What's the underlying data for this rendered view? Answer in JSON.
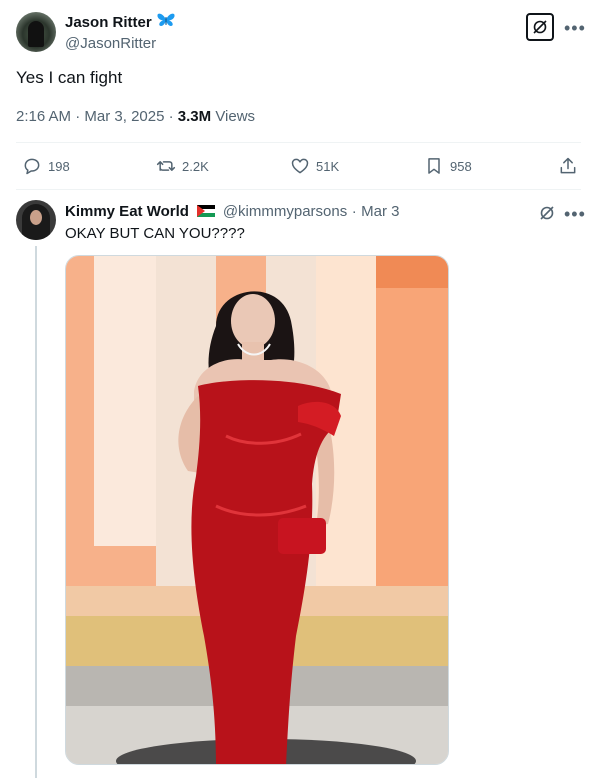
{
  "main_tweet": {
    "author_name": "Jason Ritter",
    "author_handle": "@JasonRitter",
    "text": "Yes I can fight",
    "time": "2:16 AM",
    "date": "Mar 3, 2025",
    "views_count": "3.3M",
    "views_label": "Views",
    "separator": "·",
    "actions": {
      "replies": "198",
      "reposts": "2.2K",
      "likes": "51K",
      "bookmarks": "958"
    }
  },
  "reply": {
    "author_name": "Kimmy Eat World",
    "author_handle": "@kimmmyparsons",
    "separator": "·",
    "date": "Mar 3",
    "text": "OKAY BUT CAN YOU????"
  },
  "colors": {
    "text_primary": "#0f1419",
    "text_secondary": "#536471",
    "verified_butterfly": "#1d9bf0",
    "divider": "#eff3f4",
    "dress_red": "#b8121a"
  },
  "icons": [
    "butterfly-icon",
    "grok-icon",
    "more-icon",
    "reply-icon",
    "repost-icon",
    "like-icon",
    "bookmark-icon",
    "share-icon",
    "palestine-flag-icon"
  ]
}
